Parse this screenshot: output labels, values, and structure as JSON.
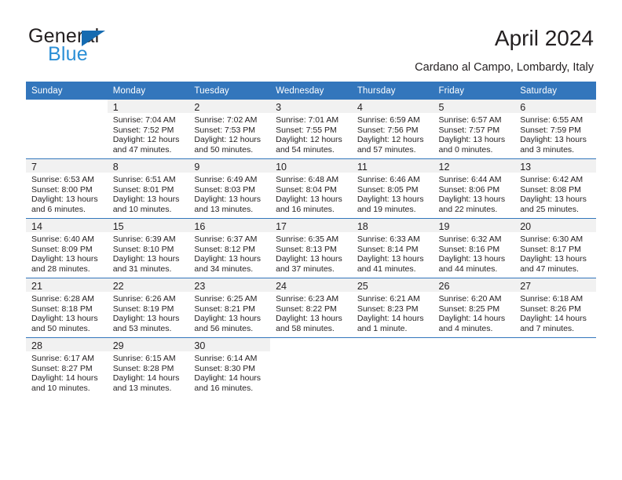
{
  "brand": {
    "name_part1": "General",
    "name_part2": "Blue",
    "accent_color": "#156bb1",
    "blue_text_color": "#2b8fd6"
  },
  "header": {
    "title": "April 2024",
    "location": "Cardano al Campo, Lombardy, Italy",
    "header_bar_color": "#3376bc",
    "daynum_band_color": "#f1f1f1"
  },
  "weekday_headers": [
    "Sunday",
    "Monday",
    "Tuesday",
    "Wednesday",
    "Thursday",
    "Friday",
    "Saturday"
  ],
  "weeks": [
    [
      {
        "day": "",
        "sunrise": "",
        "sunset": "",
        "daylight1": "",
        "daylight2": ""
      },
      {
        "day": "1",
        "sunrise": "Sunrise: 7:04 AM",
        "sunset": "Sunset: 7:52 PM",
        "daylight1": "Daylight: 12 hours",
        "daylight2": "and 47 minutes."
      },
      {
        "day": "2",
        "sunrise": "Sunrise: 7:02 AM",
        "sunset": "Sunset: 7:53 PM",
        "daylight1": "Daylight: 12 hours",
        "daylight2": "and 50 minutes."
      },
      {
        "day": "3",
        "sunrise": "Sunrise: 7:01 AM",
        "sunset": "Sunset: 7:55 PM",
        "daylight1": "Daylight: 12 hours",
        "daylight2": "and 54 minutes."
      },
      {
        "day": "4",
        "sunrise": "Sunrise: 6:59 AM",
        "sunset": "Sunset: 7:56 PM",
        "daylight1": "Daylight: 12 hours",
        "daylight2": "and 57 minutes."
      },
      {
        "day": "5",
        "sunrise": "Sunrise: 6:57 AM",
        "sunset": "Sunset: 7:57 PM",
        "daylight1": "Daylight: 13 hours",
        "daylight2": "and 0 minutes."
      },
      {
        "day": "6",
        "sunrise": "Sunrise: 6:55 AM",
        "sunset": "Sunset: 7:59 PM",
        "daylight1": "Daylight: 13 hours",
        "daylight2": "and 3 minutes."
      }
    ],
    [
      {
        "day": "7",
        "sunrise": "Sunrise: 6:53 AM",
        "sunset": "Sunset: 8:00 PM",
        "daylight1": "Daylight: 13 hours",
        "daylight2": "and 6 minutes."
      },
      {
        "day": "8",
        "sunrise": "Sunrise: 6:51 AM",
        "sunset": "Sunset: 8:01 PM",
        "daylight1": "Daylight: 13 hours",
        "daylight2": "and 10 minutes."
      },
      {
        "day": "9",
        "sunrise": "Sunrise: 6:49 AM",
        "sunset": "Sunset: 8:03 PM",
        "daylight1": "Daylight: 13 hours",
        "daylight2": "and 13 minutes."
      },
      {
        "day": "10",
        "sunrise": "Sunrise: 6:48 AM",
        "sunset": "Sunset: 8:04 PM",
        "daylight1": "Daylight: 13 hours",
        "daylight2": "and 16 minutes."
      },
      {
        "day": "11",
        "sunrise": "Sunrise: 6:46 AM",
        "sunset": "Sunset: 8:05 PM",
        "daylight1": "Daylight: 13 hours",
        "daylight2": "and 19 minutes."
      },
      {
        "day": "12",
        "sunrise": "Sunrise: 6:44 AM",
        "sunset": "Sunset: 8:06 PM",
        "daylight1": "Daylight: 13 hours",
        "daylight2": "and 22 minutes."
      },
      {
        "day": "13",
        "sunrise": "Sunrise: 6:42 AM",
        "sunset": "Sunset: 8:08 PM",
        "daylight1": "Daylight: 13 hours",
        "daylight2": "and 25 minutes."
      }
    ],
    [
      {
        "day": "14",
        "sunrise": "Sunrise: 6:40 AM",
        "sunset": "Sunset: 8:09 PM",
        "daylight1": "Daylight: 13 hours",
        "daylight2": "and 28 minutes."
      },
      {
        "day": "15",
        "sunrise": "Sunrise: 6:39 AM",
        "sunset": "Sunset: 8:10 PM",
        "daylight1": "Daylight: 13 hours",
        "daylight2": "and 31 minutes."
      },
      {
        "day": "16",
        "sunrise": "Sunrise: 6:37 AM",
        "sunset": "Sunset: 8:12 PM",
        "daylight1": "Daylight: 13 hours",
        "daylight2": "and 34 minutes."
      },
      {
        "day": "17",
        "sunrise": "Sunrise: 6:35 AM",
        "sunset": "Sunset: 8:13 PM",
        "daylight1": "Daylight: 13 hours",
        "daylight2": "and 37 minutes."
      },
      {
        "day": "18",
        "sunrise": "Sunrise: 6:33 AM",
        "sunset": "Sunset: 8:14 PM",
        "daylight1": "Daylight: 13 hours",
        "daylight2": "and 41 minutes."
      },
      {
        "day": "19",
        "sunrise": "Sunrise: 6:32 AM",
        "sunset": "Sunset: 8:16 PM",
        "daylight1": "Daylight: 13 hours",
        "daylight2": "and 44 minutes."
      },
      {
        "day": "20",
        "sunrise": "Sunrise: 6:30 AM",
        "sunset": "Sunset: 8:17 PM",
        "daylight1": "Daylight: 13 hours",
        "daylight2": "and 47 minutes."
      }
    ],
    [
      {
        "day": "21",
        "sunrise": "Sunrise: 6:28 AM",
        "sunset": "Sunset: 8:18 PM",
        "daylight1": "Daylight: 13 hours",
        "daylight2": "and 50 minutes."
      },
      {
        "day": "22",
        "sunrise": "Sunrise: 6:26 AM",
        "sunset": "Sunset: 8:19 PM",
        "daylight1": "Daylight: 13 hours",
        "daylight2": "and 53 minutes."
      },
      {
        "day": "23",
        "sunrise": "Sunrise: 6:25 AM",
        "sunset": "Sunset: 8:21 PM",
        "daylight1": "Daylight: 13 hours",
        "daylight2": "and 56 minutes."
      },
      {
        "day": "24",
        "sunrise": "Sunrise: 6:23 AM",
        "sunset": "Sunset: 8:22 PM",
        "daylight1": "Daylight: 13 hours",
        "daylight2": "and 58 minutes."
      },
      {
        "day": "25",
        "sunrise": "Sunrise: 6:21 AM",
        "sunset": "Sunset: 8:23 PM",
        "daylight1": "Daylight: 14 hours",
        "daylight2": "and 1 minute."
      },
      {
        "day": "26",
        "sunrise": "Sunrise: 6:20 AM",
        "sunset": "Sunset: 8:25 PM",
        "daylight1": "Daylight: 14 hours",
        "daylight2": "and 4 minutes."
      },
      {
        "day": "27",
        "sunrise": "Sunrise: 6:18 AM",
        "sunset": "Sunset: 8:26 PM",
        "daylight1": "Daylight: 14 hours",
        "daylight2": "and 7 minutes."
      }
    ],
    [
      {
        "day": "28",
        "sunrise": "Sunrise: 6:17 AM",
        "sunset": "Sunset: 8:27 PM",
        "daylight1": "Daylight: 14 hours",
        "daylight2": "and 10 minutes."
      },
      {
        "day": "29",
        "sunrise": "Sunrise: 6:15 AM",
        "sunset": "Sunset: 8:28 PM",
        "daylight1": "Daylight: 14 hours",
        "daylight2": "and 13 minutes."
      },
      {
        "day": "30",
        "sunrise": "Sunrise: 6:14 AM",
        "sunset": "Sunset: 8:30 PM",
        "daylight1": "Daylight: 14 hours",
        "daylight2": "and 16 minutes."
      },
      {
        "day": "",
        "sunrise": "",
        "sunset": "",
        "daylight1": "",
        "daylight2": ""
      },
      {
        "day": "",
        "sunrise": "",
        "sunset": "",
        "daylight1": "",
        "daylight2": ""
      },
      {
        "day": "",
        "sunrise": "",
        "sunset": "",
        "daylight1": "",
        "daylight2": ""
      },
      {
        "day": "",
        "sunrise": "",
        "sunset": "",
        "daylight1": "",
        "daylight2": ""
      }
    ]
  ]
}
